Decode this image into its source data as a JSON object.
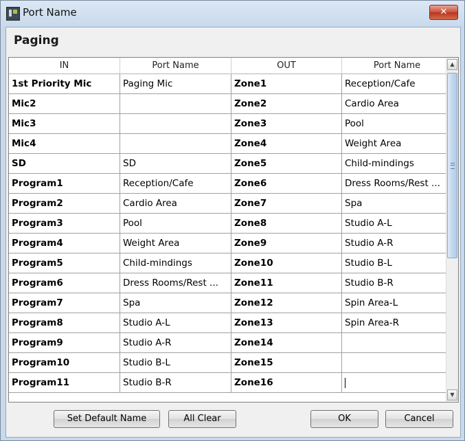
{
  "window": {
    "title": "Port Name",
    "close_label": "✕"
  },
  "section_title": "Paging",
  "columns": [
    "IN",
    "Port Name",
    "OUT",
    "Port Name"
  ],
  "rows": [
    {
      "in": "1st Priority Mic",
      "in_name": "Paging Mic",
      "out": "Zone1",
      "out_name": "Reception/Cafe"
    },
    {
      "in": "Mic2",
      "in_name": "",
      "out": "Zone2",
      "out_name": "Cardio Area"
    },
    {
      "in": "Mic3",
      "in_name": "",
      "out": "Zone3",
      "out_name": "Pool"
    },
    {
      "in": "Mic4",
      "in_name": "",
      "out": "Zone4",
      "out_name": "Weight Area"
    },
    {
      "in": "SD",
      "in_name": "SD",
      "out": "Zone5",
      "out_name": "Child-mindings"
    },
    {
      "in": "Program1",
      "in_name": "Reception/Cafe",
      "out": "Zone6",
      "out_name": "Dress Rooms/Rest ..."
    },
    {
      "in": "Program2",
      "in_name": "Cardio Area",
      "out": "Zone7",
      "out_name": "Spa"
    },
    {
      "in": "Program3",
      "in_name": "Pool",
      "out": "Zone8",
      "out_name": "Studio A-L"
    },
    {
      "in": "Program4",
      "in_name": "Weight Area",
      "out": "Zone9",
      "out_name": "Studio A-R"
    },
    {
      "in": "Program5",
      "in_name": "Child-mindings",
      "out": "Zone10",
      "out_name": "Studio B-L"
    },
    {
      "in": "Program6",
      "in_name": "Dress Rooms/Rest ...",
      "out": "Zone11",
      "out_name": "Studio B-R"
    },
    {
      "in": "Program7",
      "in_name": "Spa",
      "out": "Zone12",
      "out_name": "Spin Area-L"
    },
    {
      "in": "Program8",
      "in_name": "Studio A-L",
      "out": "Zone13",
      "out_name": "Spin Area-R"
    },
    {
      "in": "Program9",
      "in_name": "Studio A-R",
      "out": "Zone14",
      "out_name": ""
    },
    {
      "in": "Program10",
      "in_name": "Studio B-L",
      "out": "Zone15",
      "out_name": ""
    },
    {
      "in": "Program11",
      "in_name": "Studio B-R",
      "out": "Zone16",
      "out_name": ""
    }
  ],
  "scrollbar": {
    "up_arrow": "▲",
    "down_arrow": "▼"
  },
  "buttons": {
    "set_default": "Set Default Name",
    "all_clear": "All Clear",
    "ok": "OK",
    "cancel": "Cancel"
  }
}
